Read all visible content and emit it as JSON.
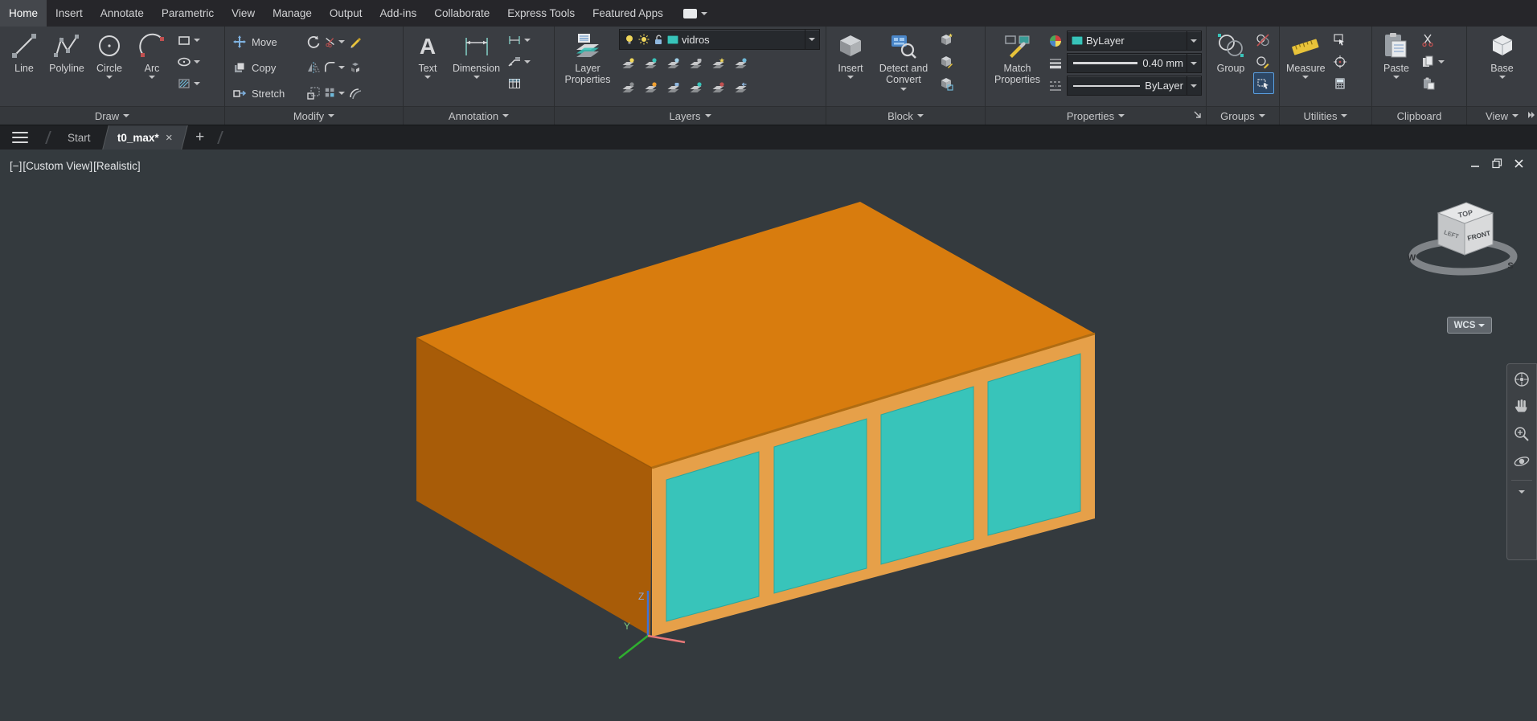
{
  "colors": {
    "roof": "#d87c0e",
    "side": "#a85c08",
    "frame": "#e6a049",
    "window": "#38c4ba",
    "teal": "#38c4ba"
  },
  "menubar": {
    "tabs": [
      "Home",
      "Insert",
      "Annotate",
      "Parametric",
      "View",
      "Manage",
      "Output",
      "Add-ins",
      "Collaborate",
      "Express Tools",
      "Featured Apps"
    ]
  },
  "ribbon": {
    "draw": {
      "label": "Draw",
      "line": "Line",
      "polyline": "Polyline",
      "circle": "Circle",
      "arc": "Arc"
    },
    "modify": {
      "label": "Modify",
      "move": "Move",
      "copy": "Copy",
      "stretch": "Stretch"
    },
    "annotation": {
      "label": "Annotation",
      "text": "Text",
      "dimension": "Dimension"
    },
    "layers": {
      "label": "Layers",
      "layer_properties": "Layer Properties",
      "active_layer": "vidros"
    },
    "block": {
      "label": "Block",
      "insert": "Insert",
      "detect": "Detect and Convert"
    },
    "properties": {
      "label": "Properties",
      "match": "Match Properties",
      "color": "ByLayer",
      "lineweight": "0.40 mm",
      "linetype": "ByLayer"
    },
    "groups": {
      "label": "Groups",
      "group": "Group"
    },
    "utilities": {
      "label": "Utilities",
      "measure": "Measure"
    },
    "clipboard": {
      "label": "Clipboard",
      "paste": "Paste"
    },
    "view": {
      "label": "View",
      "base": "Base"
    }
  },
  "tabbar": {
    "start": "Start",
    "drawing": "t0_max*",
    "new_tab": "+",
    "close_icon": "×"
  },
  "viewport": {
    "controls_min": "[−]",
    "view_name": "[Custom View]",
    "visual_style": "[Realistic]",
    "wcs": "WCS",
    "viewcube": {
      "top": "TOP",
      "front": "FRONT",
      "left": "LEFT",
      "west": "W",
      "south": "S"
    },
    "axes": {
      "y": "Y",
      "z": "Z"
    }
  }
}
